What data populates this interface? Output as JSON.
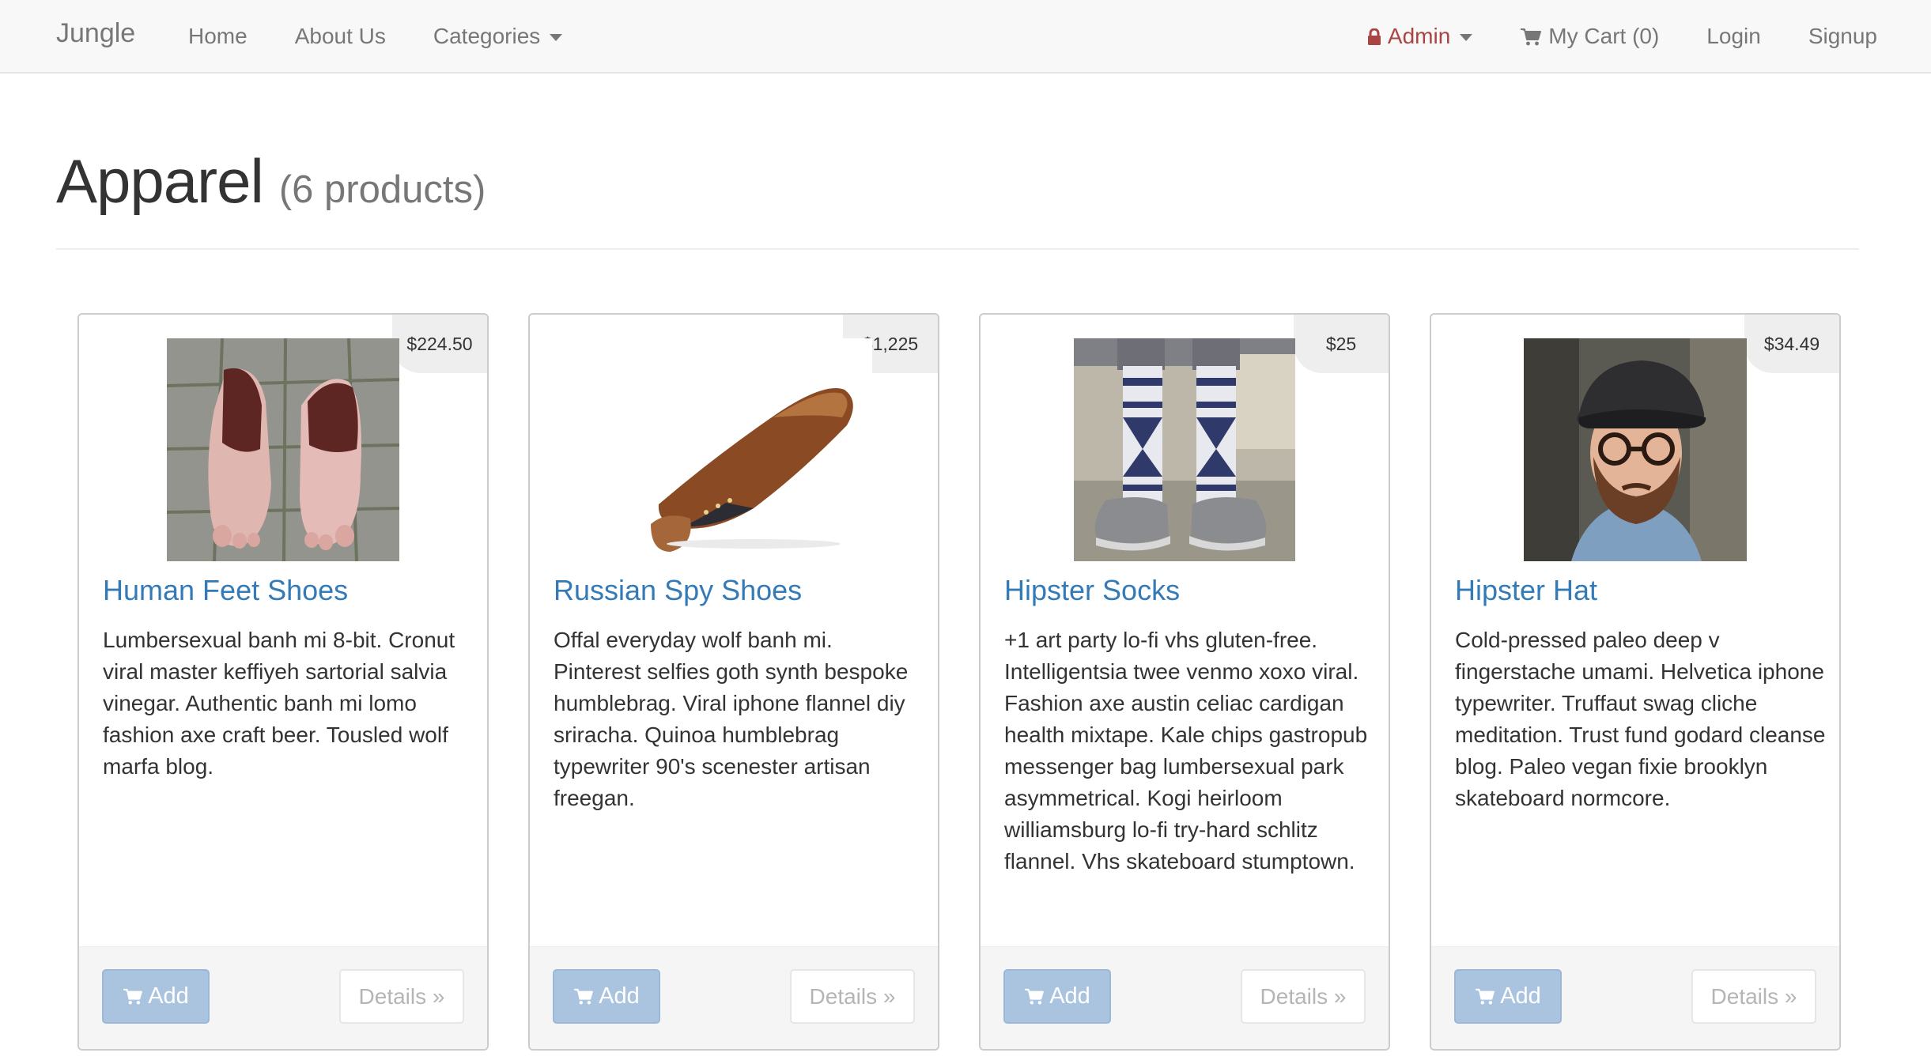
{
  "navbar": {
    "brand": "Jungle",
    "left_items": [
      {
        "label": "Home"
      },
      {
        "label": "About Us"
      },
      {
        "label": "Categories"
      }
    ],
    "admin_label": "Admin",
    "cart_label": "My Cart (0)",
    "login_label": "Login",
    "signup_label": "Signup"
  },
  "header": {
    "title": "Apparel",
    "count": "(6 products)"
  },
  "colors": {
    "link": "#337ab7",
    "admin": "#a94442",
    "add_button": "#aac4e0"
  },
  "products": [
    {
      "price": "$224.50",
      "name": "Human Feet Shoes",
      "description": "Lumbersexual banh mi 8-bit. Cronut viral master keffiyeh sartorial salvia vinegar. Authentic banh mi lomo fashion axe craft beer. Tousled wolf marfa blog.",
      "add_label": "Add",
      "details_label": "Details »"
    },
    {
      "price": "$1,225",
      "name": "Russian Spy Shoes",
      "description": "Offal everyday wolf banh mi. Pinterest selfies goth synth bespoke humblebrag. Viral iphone flannel diy sriracha. Quinoa humblebrag typewriter 90's scenester artisan freegan.",
      "add_label": "Add",
      "details_label": "Details »"
    },
    {
      "price": "$25",
      "name": "Hipster Socks",
      "description": "+1 art party lo-fi vhs gluten-free. Intelligentsia twee venmo xoxo viral. Fashion axe austin celiac cardigan health mixtape. Kale chips gastropub messenger bag lumbersexual park asymmetrical. Kogi heirloom williamsburg lo-fi try-hard schlitz flannel. Vhs skateboard stumptown.",
      "add_label": "Add",
      "details_label": "Details »"
    },
    {
      "price": "$34.49",
      "name": "Hipster Hat",
      "description": "Cold-pressed paleo deep v fingerstache umami. Helvetica iphone typewriter. Truffaut swag cliche meditation. Trust fund godard cleanse blog. Paleo vegan fixie brooklyn skateboard normcore.",
      "add_label": "Add",
      "details_label": "Details »"
    }
  ]
}
